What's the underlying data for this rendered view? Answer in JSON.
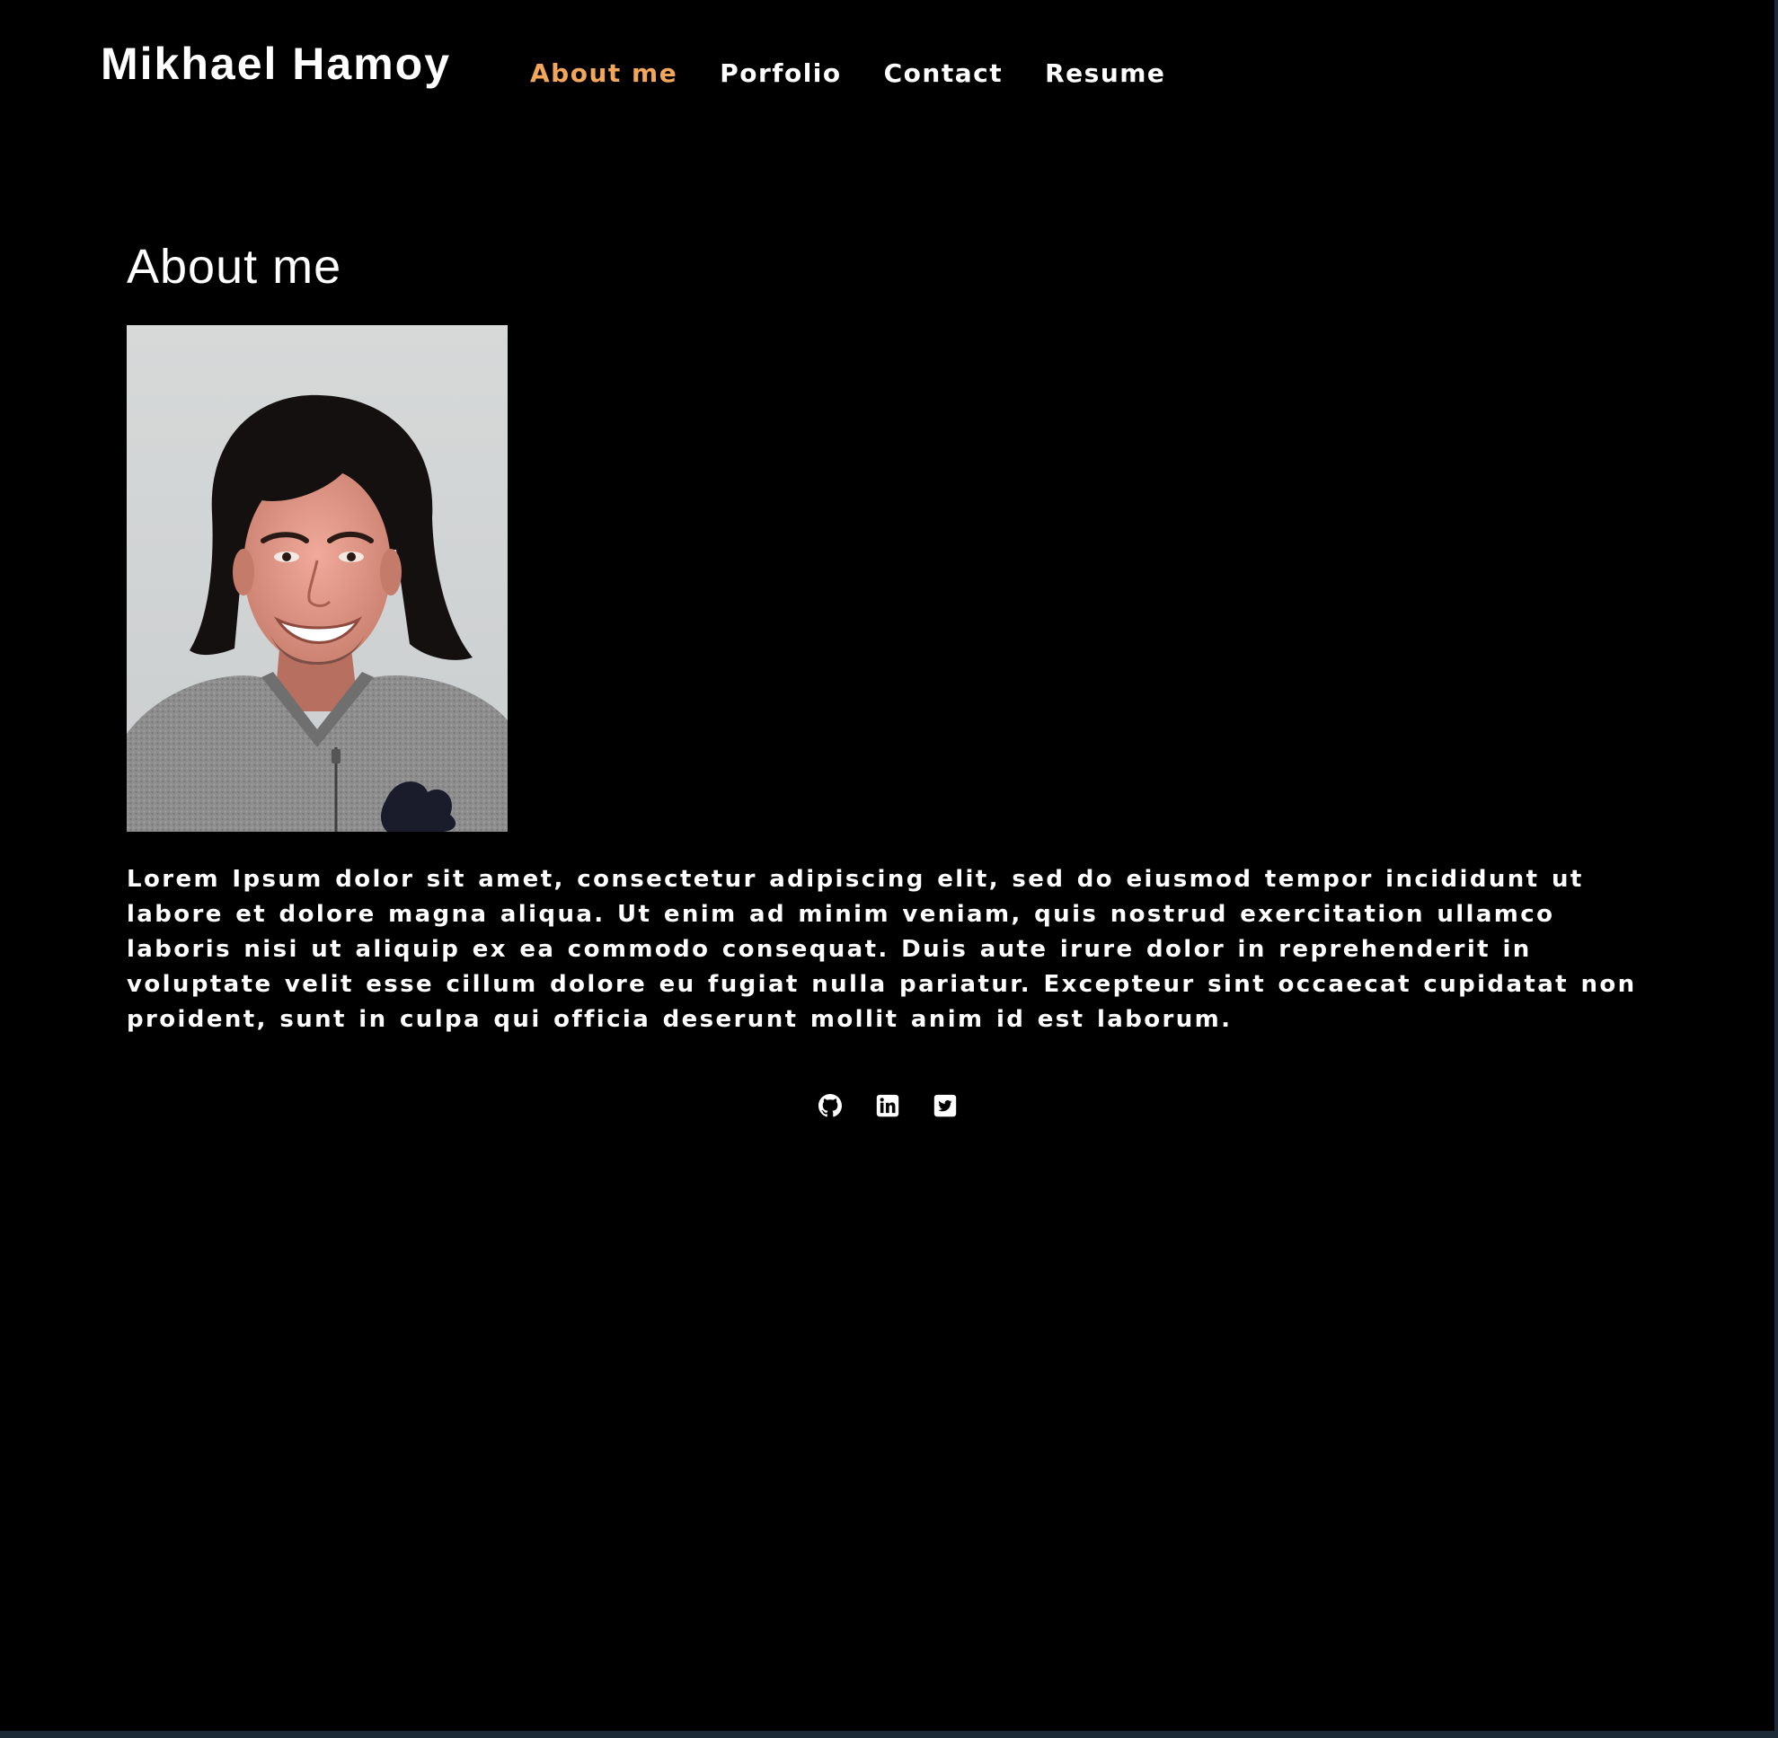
{
  "header": {
    "brand": "Mikhael Hamoy",
    "nav": [
      {
        "label": "About me",
        "active": true
      },
      {
        "label": "Porfolio",
        "active": false
      },
      {
        "label": "Contact",
        "active": false
      },
      {
        "label": "Resume",
        "active": false
      }
    ]
  },
  "about": {
    "title": "About me",
    "photo_alt": "portrait-photo",
    "bio": "Lorem Ipsum dolor sit amet, consectetur adipiscing elit, sed do eiusmod tempor incididunt ut labore et dolore magna aliqua. Ut enim ad minim veniam, quis nostrud exercitation ullamco laboris nisi ut aliquip ex ea commodo consequat. Duis aute irure dolor in reprehenderit in voluptate velit esse cillum dolore eu fugiat nulla pariatur. Excepteur sint occaecat cupidatat non proident, sunt in culpa qui officia deserunt mollit anim id est laborum."
  },
  "socials": [
    {
      "icon": "github-icon"
    },
    {
      "icon": "linkedin-icon"
    },
    {
      "icon": "twitter-icon"
    }
  ],
  "colors": {
    "background": "#000000",
    "text": "#ffffff",
    "accent": "#f2a65a"
  }
}
